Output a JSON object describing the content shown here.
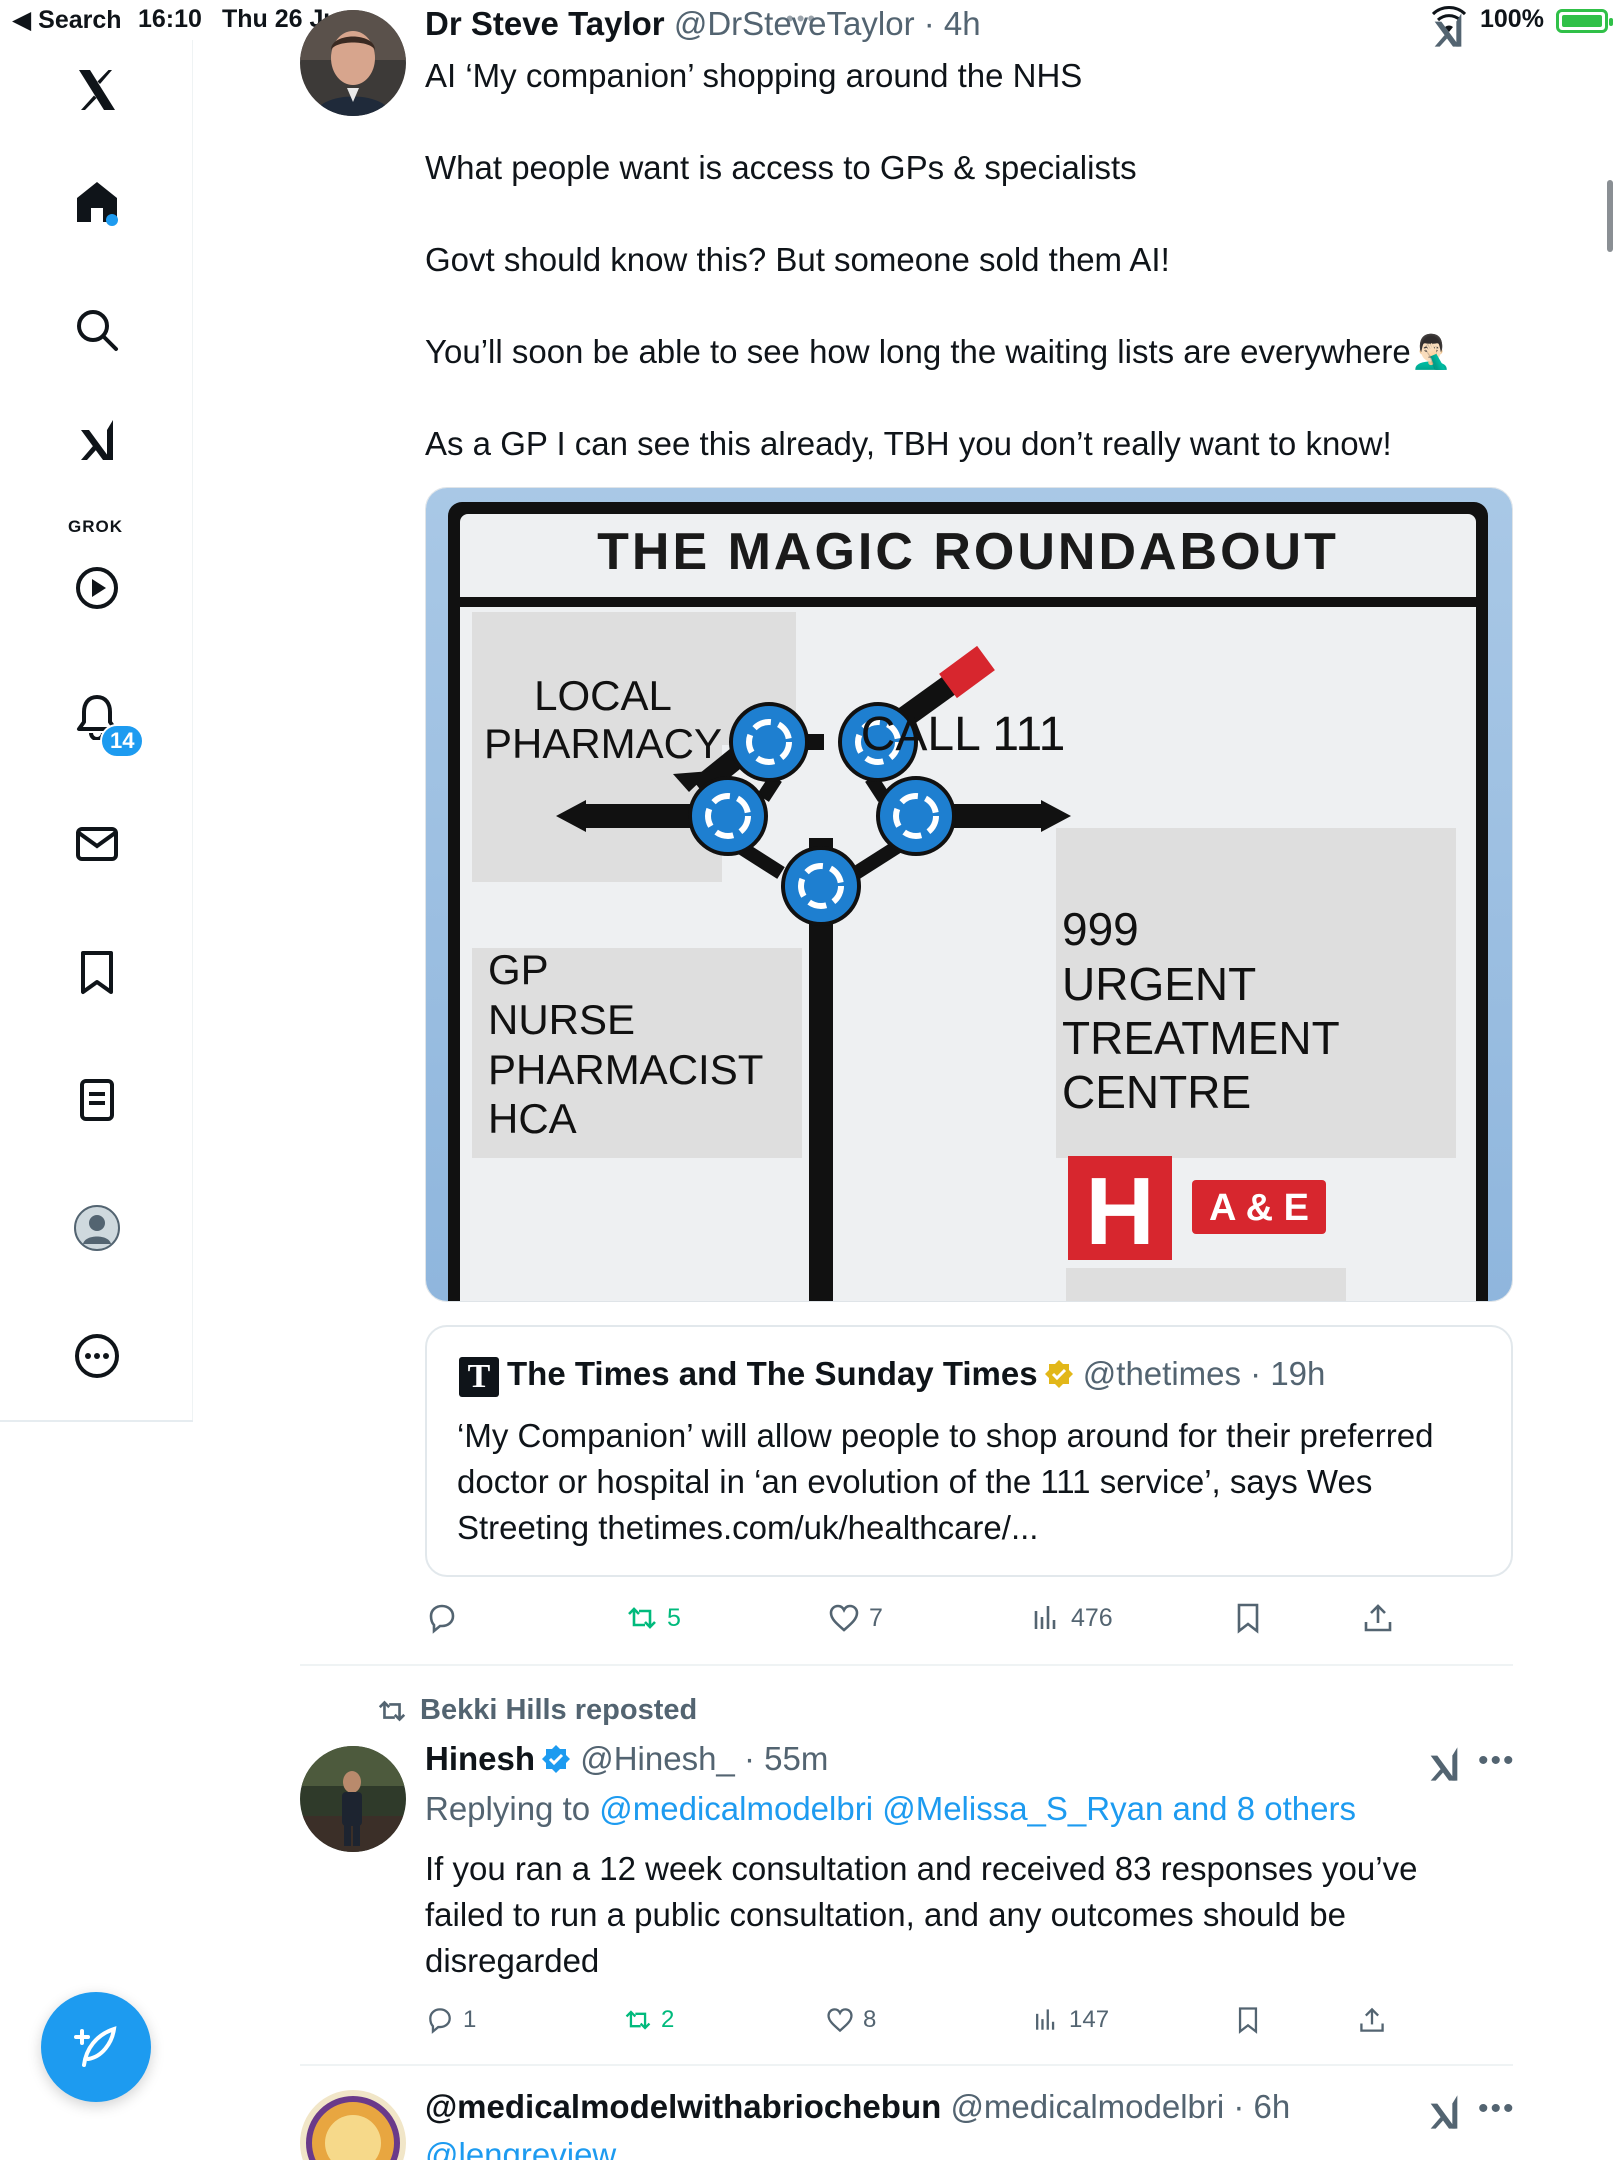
{
  "status_bar": {
    "back_label": "◀ Search",
    "time": "16:10",
    "date": "Thu 26 Jun",
    "battery_percent": "100%",
    "battery_level": 1.0
  },
  "sidebar": {
    "grok_label": "GROK",
    "notifications_count": "14"
  },
  "tweets": [
    {
      "name": "Dr Steve Taylor",
      "handle": "@DrSteveTaylor",
      "time": "· 4h",
      "text": "AI ‘My companion’ shopping around the NHS\n\nWhat people want is access to GPs & specialists\n\nGovt should know this? But someone sold them AI!\n\nYou’ll soon be able to see how long the waiting lists are everywhere🤦🏻‍♂️\n\nAs a GP I can see this already, TBH you don’t really want to know!",
      "media": {
        "sign_title": "THE MAGIC ROUNDABOUT",
        "labels": {
          "pharmacy_1": "LOCAL",
          "pharmacy_2": "PHARMACY",
          "call111": "CALL 111",
          "gp_1": "GP",
          "gp_2": "NURSE",
          "gp_3": "PHARMACIST",
          "gp_4": "HCA",
          "urgent_1": "999",
          "urgent_2": "URGENT",
          "urgent_3": "TREATMENT",
          "urgent_4": "CENTRE",
          "hospital_h": "H",
          "ae": "A & E"
        }
      },
      "quote": {
        "logo_letter": "T",
        "name": "The Times and The Sunday Times",
        "handle": "@thetimes",
        "time": "· 19h",
        "text": "‘My Companion’ will allow people to shop around for their preferred doctor or hospital in ‘an evolution of the 111 service’, says Wes Streeting thetimes.com/uk/healthcare/..."
      },
      "stats": {
        "replies": "",
        "reposts": "5",
        "likes": "7",
        "views": "476"
      }
    },
    {
      "repost_by": "Bekki Hills reposted",
      "name": "Hinesh",
      "handle": "@Hinesh_",
      "time": "· 55m",
      "replying_prefix": "Replying to ",
      "replying_to": "@medicalmodelbri @Melissa_S_Ryan and 8 others",
      "text": "If you ran a 12 week consultation and received 83 responses you’ve failed to run a public consultation, and any outcomes should be disregarded",
      "stats": {
        "replies": "1",
        "reposts": "2",
        "likes": "8",
        "views": "147"
      }
    },
    {
      "name": "@medicalmodelwithabriochebun",
      "handle": "@medicalmodelbri",
      "time": "· 6h",
      "replying_partial": "@lengreview"
    }
  ],
  "colors": {
    "accent": "#1d9bf0",
    "text": "#0f1419",
    "muted": "#536471",
    "repost_green": "#00ba7c",
    "verified_gold": "#e2b719",
    "sign_red": "#d7262e",
    "roundabout_blue": "#1e7fd0"
  },
  "icons": [
    "x-logo-icon",
    "home-icon",
    "search-icon",
    "grok-icon",
    "play-icon",
    "bell-icon",
    "mail-icon",
    "bookmark-icon",
    "list-icon",
    "profile-icon",
    "more-icon",
    "compose-icon",
    "reply-icon",
    "repost-icon",
    "like-icon",
    "views-icon",
    "share-icon"
  ]
}
